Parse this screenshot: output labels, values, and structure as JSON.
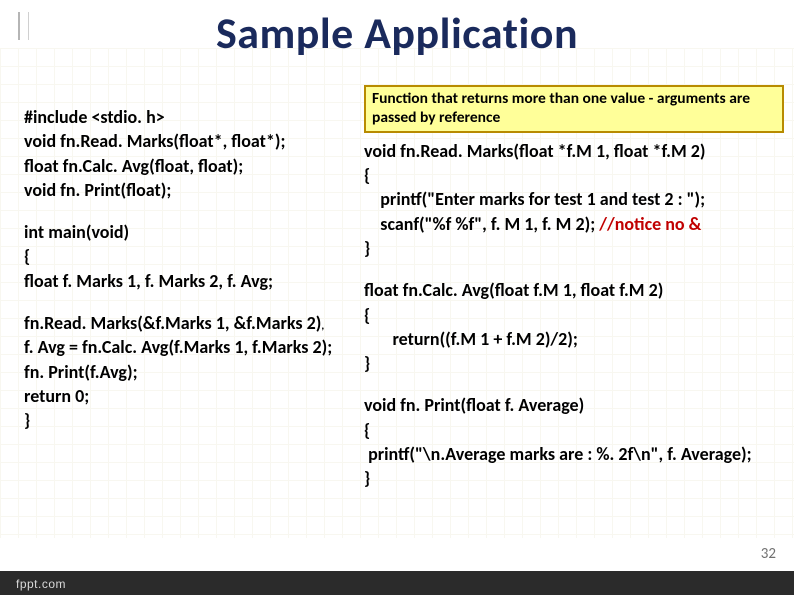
{
  "title": "Sample Application",
  "callout": "Function that returns more than one value - arguments are passed by reference",
  "left": {
    "l1": "#include <stdio. h>",
    "l2": "void fn.Read. Marks(float*, float*);",
    "l3": "float fn.Calc. Avg(float, float);",
    "l4": "void fn. Print(float);",
    "l6": "int main(void)",
    "l7": "{",
    "l8": "    float f. Marks 1, f. Marks 2, f. Avg;",
    "l10": " fn.Read. Marks(&f.Marks 1, &f.Marks 2)",
    "l10c": ";",
    "l11": "f. Avg = fn.Calc. Avg(f.Marks 1, f.Marks 2);",
    "l12": "fn. Print(f.Avg);",
    "l13": " return 0;",
    "l14": "}"
  },
  "right": {
    "r1": "void fn.Read. Marks(float *f.M 1, float *f.M 2)",
    "r2": "{",
    "r3a": "    printf(\"Enter marks for test 1 and test 2 : \");",
    "r4a": "    scanf(\"%f %f\", f. M 1, f. M 2); ",
    "r4b": "//notice no &",
    "r5": "}",
    "r7": "float fn.Calc. Avg(float f.M 1, float f.M 2)",
    "r8": "{",
    "r9": "       return((f.M 1 + f.M 2)/2);",
    "r10": "}",
    "r12": "void fn. Print(float f. Average)",
    "r13": "{",
    "r14": " printf(\"\\n.Average marks are : %. 2f\\n\", f. Average);",
    "r15": "}"
  },
  "page_number": "32",
  "footer": "fppt.com"
}
